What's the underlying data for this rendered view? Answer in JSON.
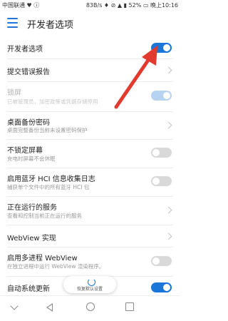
{
  "status": {
    "carrier": "中国联通 ♥ ⓘ",
    "right": "83B/s ♦ ⊘ ▲ ▮ 52% ▭ 晚上10:16"
  },
  "title": "开发者选项",
  "items": [
    {
      "title": "开发者选项",
      "control": "toggle-on"
    },
    {
      "title": "提交错误报告",
      "control": "chevron"
    },
    {
      "title": "锁屏",
      "subtitle": "已被管理员，加密政策或凭据存储停用",
      "control": "toggle-on-disabled"
    },
    {
      "title": "桌面备份密码",
      "subtitle": "桌面完整备份当前未设置密码保护",
      "control": "chevron"
    },
    {
      "title": "不锁定屏幕",
      "subtitle": "充电时屏幕不会休眠",
      "control": "toggle-off"
    },
    {
      "title": "启用蓝牙 HCI 信息收集日志",
      "subtitle": "捕获单个文件中的所有蓝牙 HCI 包",
      "control": "toggle-off"
    },
    {
      "title": "正在运行的服务",
      "subtitle": "查看和控制当前正在运行的服务",
      "control": "chevron"
    },
    {
      "title": "WebView 实现",
      "control": "chevron"
    },
    {
      "title": "启用多进程 WebView",
      "subtitle": "在独立进程中运行 WebView 渲染程序。",
      "control": "toggle-off"
    },
    {
      "title": "自动系统更新",
      "control": "toggle-on"
    }
  ],
  "restore_label": "恢复默认设置",
  "colors": {
    "accent": "#1a77d9",
    "arrow": "#e23a2e"
  }
}
